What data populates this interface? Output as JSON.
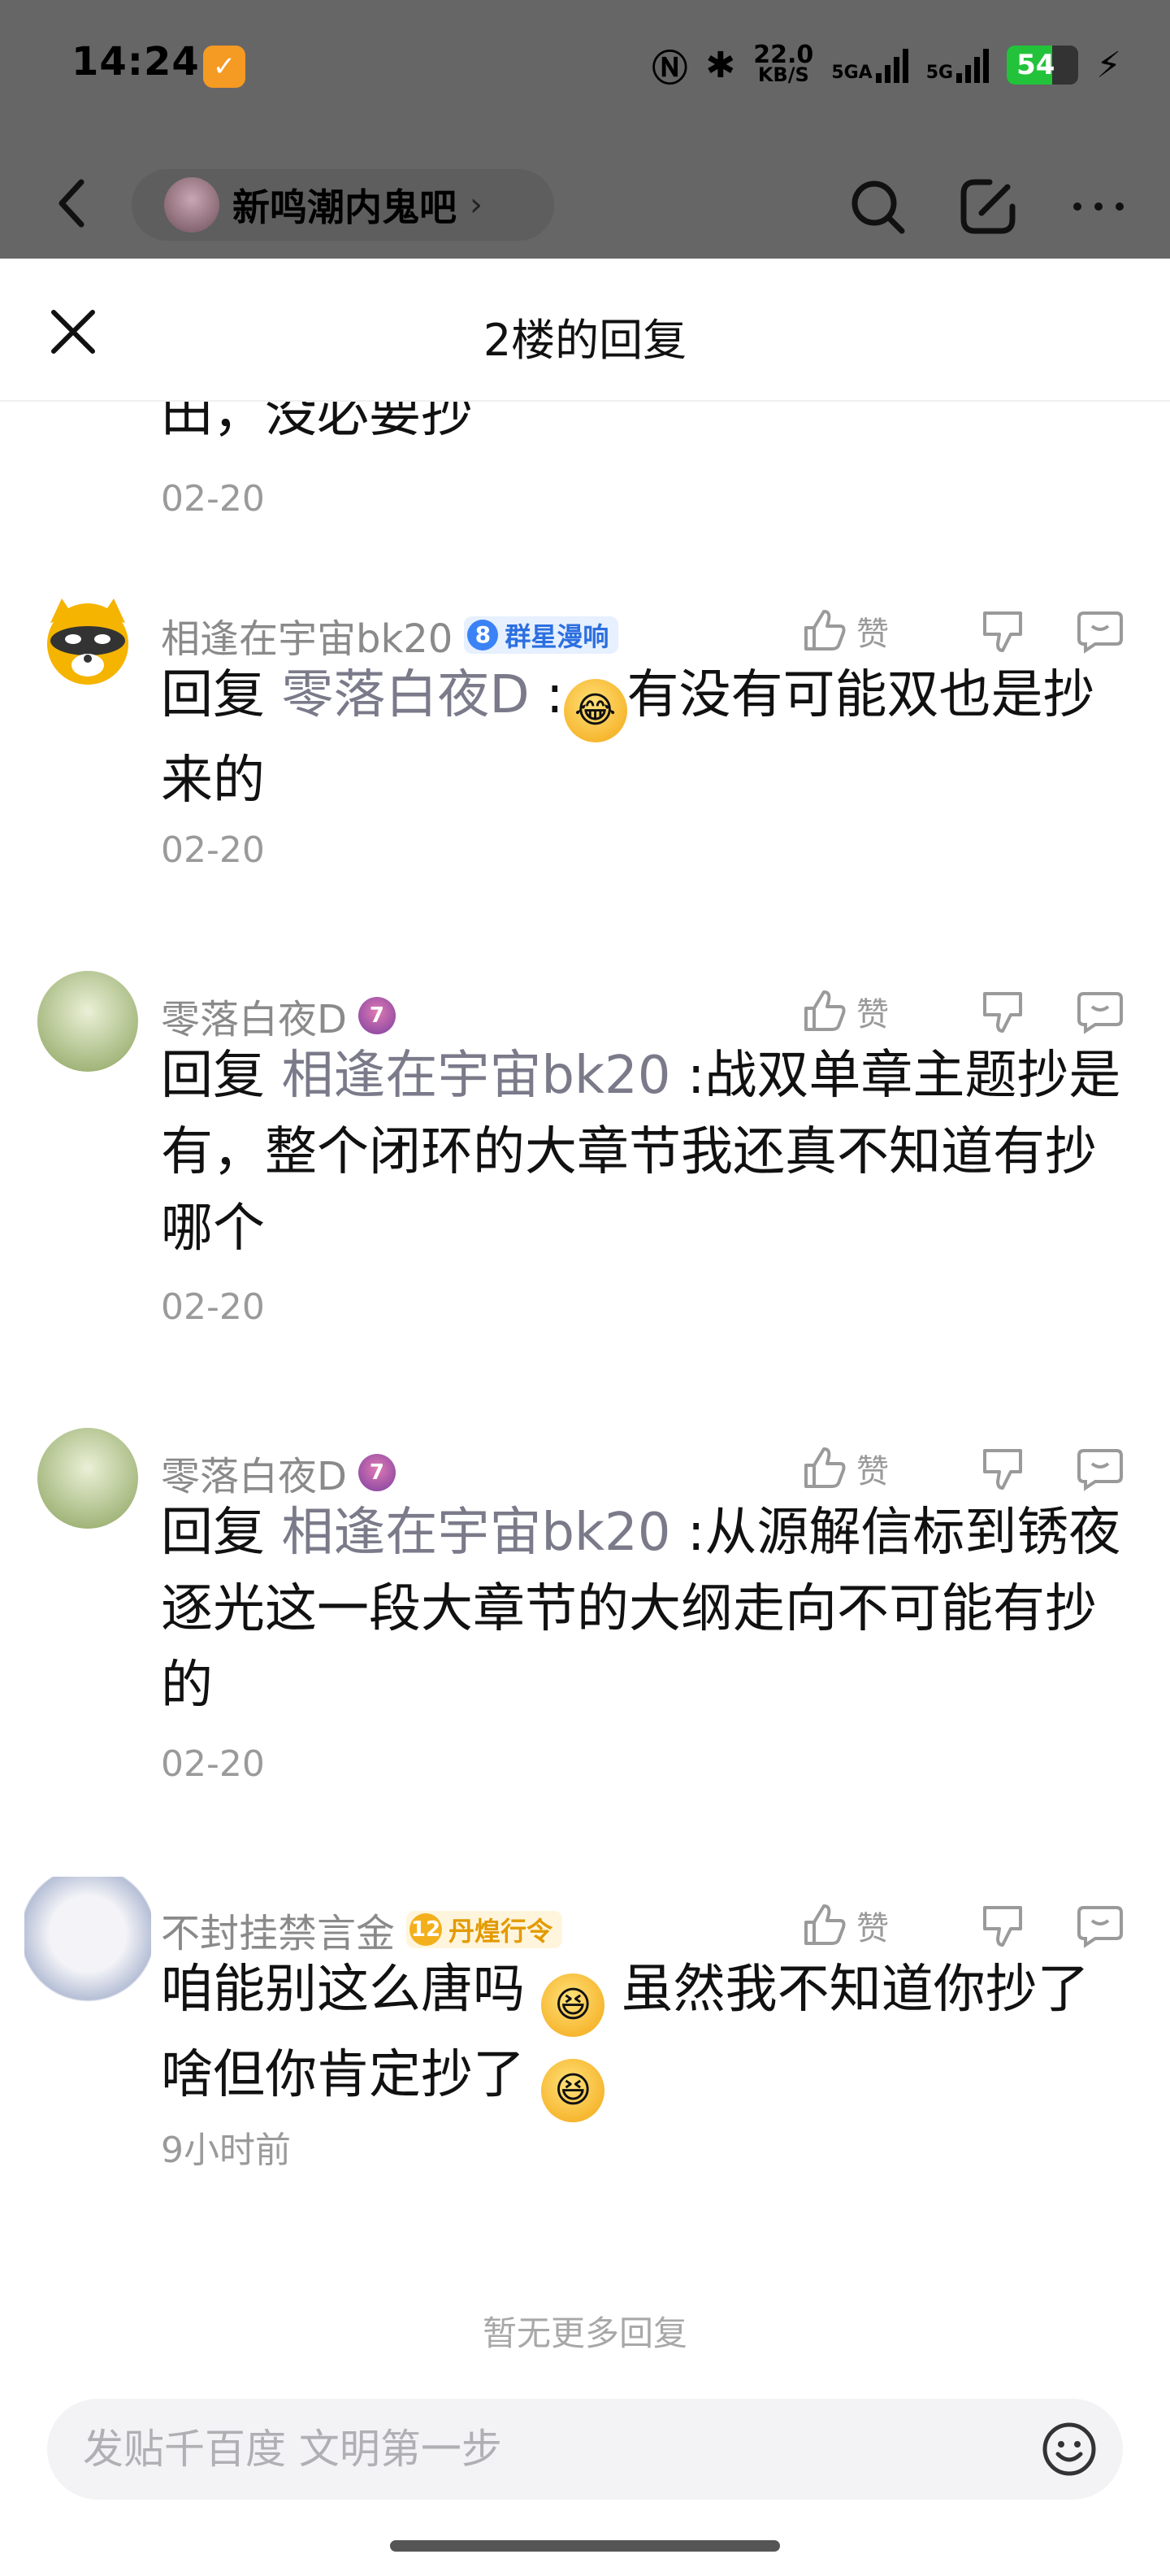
{
  "status_bar": {
    "time": "14:24",
    "net_speed_value": "22.0",
    "net_speed_unit": "KB/S",
    "signal1": "5GA",
    "signal2": "5G",
    "battery": "54"
  },
  "nav": {
    "forum_name": "新鸣潮内鬼吧",
    "chevron": "›"
  },
  "sheet": {
    "title": "2楼的回复",
    "partial_text": "田，没必要抄",
    "partial_date": "02-20"
  },
  "comments": [
    {
      "username": "相逢在宇宙bk20",
      "badge_level": "8",
      "badge_text": "群星漫响",
      "like_label": "赞",
      "reply_prefix": "回复",
      "mention": "零落白夜D",
      "text_before_emoji": ":",
      "emoji": "rolling-on-floor-laughing",
      "text_after_emoji": "有没有可能双也是抄来的",
      "date": "02-20"
    },
    {
      "username": "零落白夜D",
      "vip_level": "7",
      "like_label": "赞",
      "reply_prefix": "回复",
      "mention": "相逢在宇宙bk20",
      "text": ":战双单章主题抄是有，整个闭环的大章节我还真不知道有抄哪个",
      "date": "02-20"
    },
    {
      "username": "零落白夜D",
      "vip_level": "7",
      "like_label": "赞",
      "reply_prefix": "回复",
      "mention": "相逢在宇宙bk20",
      "text": ":从源解信标到锈夜逐光这一段大章节的大纲走向不可能有抄的",
      "date": "02-20"
    },
    {
      "username": "不封挂禁言金",
      "badge_level": "12",
      "badge_text": "丹煌行令",
      "like_label": "赞",
      "text_part1": "咱能别这么唐吗",
      "text_part2": "虽然我不知道你抄了啥但你肯定抄了",
      "emoji": "grinning-squinting-face",
      "date": "9小时前"
    }
  ],
  "footer": {
    "no_more": "暂无更多回复",
    "input_placeholder": "发贴千百度 文明第一步"
  },
  "colors": {
    "overlay": "#666666",
    "mention": "#7a7a8a",
    "meta": "#9a9a9a",
    "badge_blue": "#2c6fe0",
    "badge_gold": "#e39a00"
  }
}
